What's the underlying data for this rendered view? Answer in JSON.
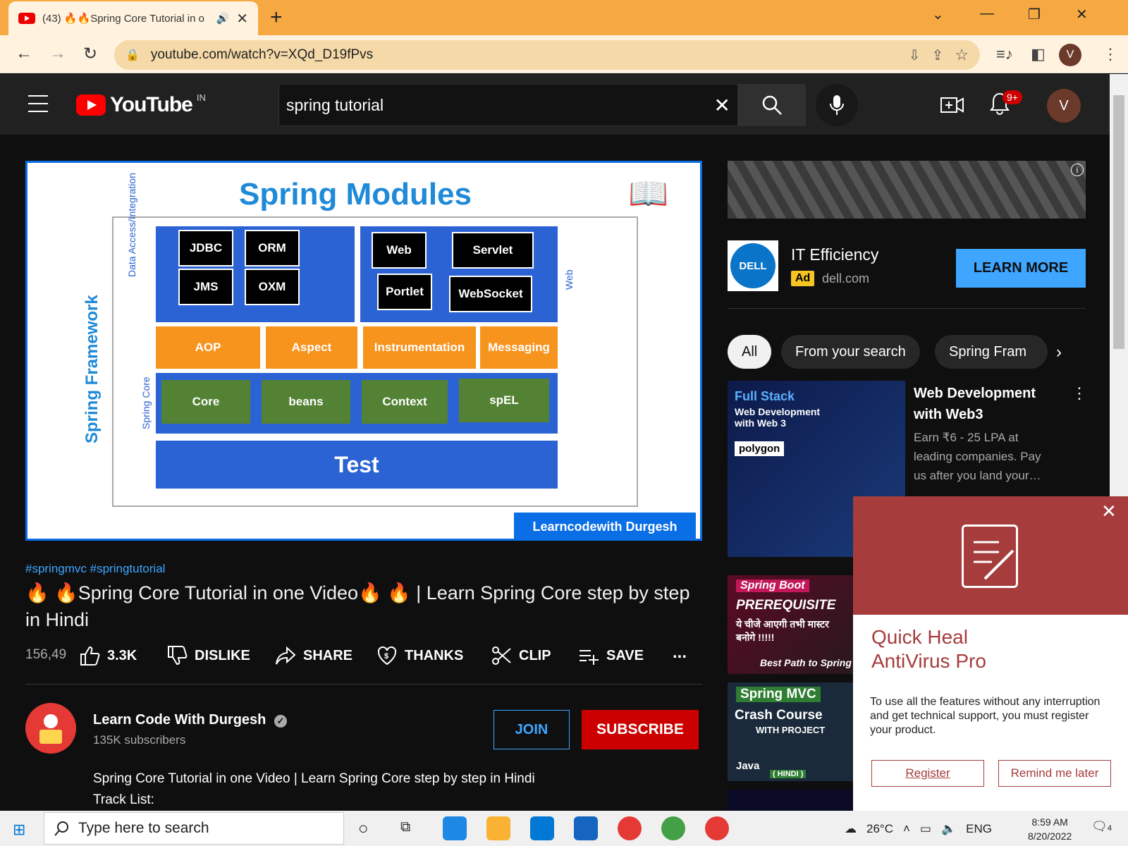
{
  "browser": {
    "tab_title": "(43) 🔥🔥Spring Core Tutorial in o",
    "new_tab": "+",
    "url": "youtube.com/watch?v=XQd_D19fPvs",
    "profile_initial": "V"
  },
  "youtube": {
    "logo_word": "YouTube",
    "region": "IN",
    "search_value": "spring tutorial",
    "notif_count": "9+",
    "avatar_initial": "V"
  },
  "video": {
    "slide_title": "Spring Modules",
    "spring_framework_label": "Spring Framework",
    "data_access_label": "Data Access/Integration",
    "web_label": "Web",
    "spring_core_label": "Spring Core",
    "data_modules": [
      "JDBC",
      "ORM",
      "JMS",
      "OXM"
    ],
    "web_modules": [
      "Web",
      "Servlet",
      "Portlet",
      "WebSocket"
    ],
    "middle_modules": [
      "AOP",
      "Aspect",
      "Instrumentation",
      "Messaging"
    ],
    "core_modules": [
      "Core",
      "beans",
      "Context",
      "spEL"
    ],
    "test_label": "Test",
    "brand": "Learncodewith Durgesh"
  },
  "meta": {
    "tags": "#springmvc #springtutorial",
    "title": "🔥 🔥Spring Core Tutorial in one Video🔥 🔥 | Learn Spring Core step by step in Hindi",
    "views": "156,49",
    "likes": "3.3K",
    "dislike": "DISLIKE",
    "share": "SHARE",
    "thanks": "THANKS",
    "clip": "CLIP",
    "save": "SAVE",
    "more": "...",
    "channel_name": "Learn Code With Durgesh",
    "subscribers": "135K subscribers",
    "join": "JOIN",
    "subscribe": "SUBSCRIBE",
    "desc_line1": "Spring Core Tutorial in one Video | Learn Spring Core step by step in Hindi",
    "desc_line2": "Track List:"
  },
  "ad": {
    "logo": "DELL",
    "title": "IT Efficiency",
    "tag": "Ad",
    "domain": "dell.com",
    "cta": "LEARN MORE"
  },
  "chips": [
    "All",
    "From your search",
    "Spring Fram"
  ],
  "recommended": [
    {
      "title": "Web Development with Web3",
      "desc": "Earn ₹6 - 25 LPA at leading companies. Pay us after you land your…",
      "thumb_text": [
        "Full Stack",
        "Web Development with Web 3",
        "polygon"
      ]
    },
    {
      "thumb_text": [
        "Spring Boot",
        "PREREQUISITE",
        "ये चीजे आएगी तभी मास्टर बनोगे !!!!!",
        "Best Path to Spring"
      ]
    },
    {
      "thumb_text": [
        "Spring MVC",
        "Crash Course",
        "WITH PROJECT",
        "Java",
        "( HINDI )"
      ]
    }
  ],
  "popup": {
    "title_line1": "Quick Heal",
    "title_line2": "AntiVirus Pro",
    "message": "To use all the features without any interruption and get technical support, you must register your product.",
    "register": "Register",
    "remind": "Remind me later"
  },
  "taskbar": {
    "search_placeholder": "Type here to search",
    "temp": "26°C",
    "lang": "ENG",
    "time": "8:59 AM",
    "date": "8/20/2022",
    "notif": "4"
  }
}
